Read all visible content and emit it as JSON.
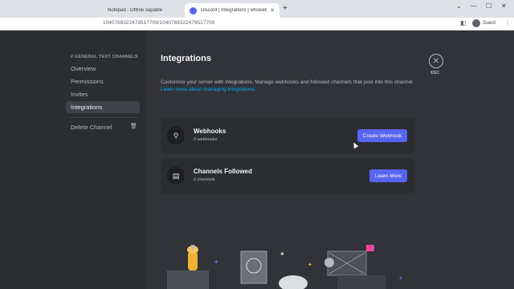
{
  "browser": {
    "tabs": [
      {
        "title": "Notepad - Offline capable",
        "close": "✕"
      },
      {
        "title": "Discord | Integrations | whswebh",
        "close": "✕"
      }
    ],
    "new_tab": "+",
    "window_controls": [
      "⌄",
      "—",
      "☐",
      "✕"
    ],
    "url": "1040769322479517706/1040769322479517709",
    "profile_label": "Guest",
    "menu_icon": "⋮"
  },
  "sidebar": {
    "category": "# GENERAL TEXT CHANNELS",
    "items": [
      {
        "label": "Overview"
      },
      {
        "label": "Permissions"
      },
      {
        "label": "Invites"
      },
      {
        "label": "Integrations"
      }
    ],
    "delete_label": "Delete Channel"
  },
  "main": {
    "title": "Integrations",
    "description": "Customize your server with integrations. Manage webhooks and followed channels that post into this channel.",
    "learn_link": "Learn more about managing integrations.",
    "cards": [
      {
        "title": "Webhooks",
        "subtitle": "0 webhooks",
        "button": "Create Webhook",
        "icon": "webhook-icon"
      },
      {
        "title": "Channels Followed",
        "subtitle": "0 channels",
        "button": "Learn More",
        "icon": "channels-followed-icon"
      }
    ],
    "esc_label": "ESC"
  },
  "colors": {
    "accent": "#5865f2",
    "link": "#00a8fc",
    "background": "#313338",
    "sidebar": "#2b2d31"
  }
}
